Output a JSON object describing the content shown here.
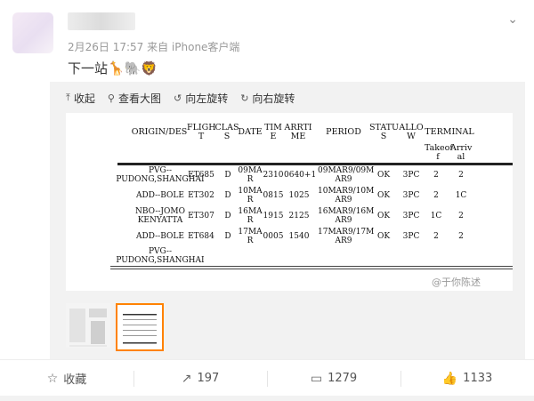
{
  "post": {
    "meta": "2月26日 17:57 来自 iPhone客户端",
    "text": "下一站🦒🐘🦁"
  },
  "toolbar": {
    "collapse": "收起",
    "view_large": "查看大图",
    "rotate_left": "向左旋转",
    "rotate_right": "向右旋转"
  },
  "document": {
    "headers": {
      "origin": "ORIGIN/DES",
      "flight": [
        "FLIGH",
        "T"
      ],
      "class": [
        "CLAS",
        "S"
      ],
      "date": "DATE",
      "time": [
        "TIM",
        "E"
      ],
      "arrtime": [
        "ARRTI",
        "ME"
      ],
      "period": "PERIOD",
      "status": [
        "STATU",
        "S"
      ],
      "allow": [
        "ALLO",
        "W"
      ],
      "terminal": "TERMINAL",
      "takeoff": [
        "Takeof",
        "f"
      ],
      "arrival": [
        "Arriv",
        "al"
      ]
    },
    "rows": [
      {
        "origin": [
          "PVG--",
          "PUDONG,SHANGHAI"
        ],
        "flight": "ET685",
        "class": "D",
        "date": [
          "09MA",
          "R"
        ],
        "time": "2310",
        "arr": "0640+1",
        "period": [
          "09MAR9/09M",
          "AR9"
        ],
        "status": "OK",
        "allow": "3PC",
        "tk": "2",
        "ar": "2"
      },
      {
        "origin": [
          "ADD--BOLE"
        ],
        "flight": "ET302",
        "class": "D",
        "date": [
          "10MA",
          "R"
        ],
        "time": "0815",
        "arr": "1025",
        "period": [
          "10MAR9/10M",
          "AR9"
        ],
        "status": "OK",
        "allow": "3PC",
        "tk": "2",
        "ar": "1C"
      },
      {
        "origin": [
          "NBO--JOMO",
          "KENYATTA"
        ],
        "flight": "ET307",
        "class": "D",
        "date": [
          "16MA",
          "R"
        ],
        "time": "1915",
        "arr": "2125",
        "period": [
          "16MAR9/16M",
          "AR9"
        ],
        "status": "OK",
        "allow": "3PC",
        "tk": "1C",
        "ar": "2"
      },
      {
        "origin": [
          "ADD--BOLE"
        ],
        "flight": "ET684",
        "class": "D",
        "date": [
          "17MA",
          "R"
        ],
        "time": "0005",
        "arr": "1540",
        "period": [
          "17MAR9/17M",
          "AR9"
        ],
        "status": "OK",
        "allow": "3PC",
        "tk": "2",
        "ar": "2"
      },
      {
        "origin": [
          "PVG--",
          "PUDONG,SHANGHAI"
        ]
      }
    ]
  },
  "watermark": "@于你陈述",
  "actions": {
    "favorite": "收藏",
    "repost": "197",
    "comment": "1279",
    "like": "1133"
  },
  "colors": {
    "accent": "#ff8200",
    "meta_text": "#999999",
    "media_bg": "#f2f2f2"
  }
}
